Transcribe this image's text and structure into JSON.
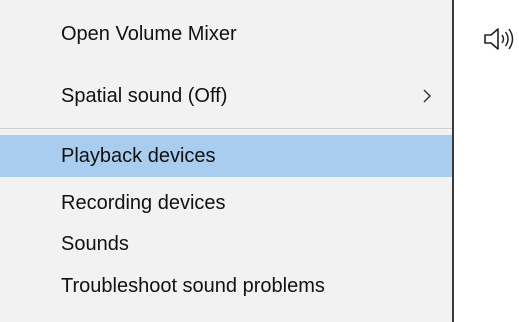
{
  "menu": {
    "items": [
      {
        "label": "Open Volume Mixer"
      },
      {
        "label": "Spatial sound (Off)",
        "has_submenu": true
      },
      {
        "label": "Playback devices",
        "highlighted": true
      },
      {
        "label": "Recording devices"
      },
      {
        "label": "Sounds"
      },
      {
        "label": "Troubleshoot sound problems"
      }
    ]
  },
  "tray": {
    "icon": "speaker-volume-icon"
  },
  "colors": {
    "menu_background": "#f2f2f2",
    "highlight": "#a9cdee",
    "text": "#111111"
  }
}
